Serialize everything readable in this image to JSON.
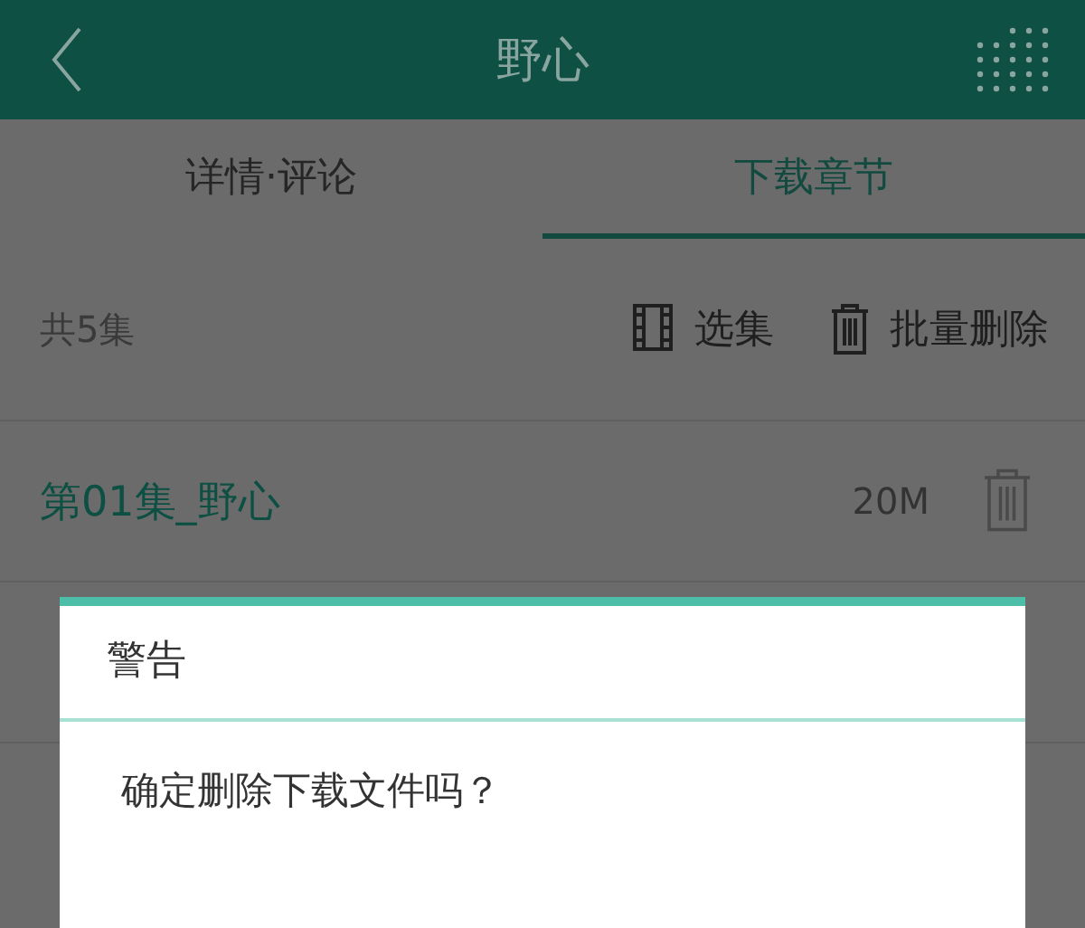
{
  "header": {
    "title": "野心"
  },
  "tabs": [
    {
      "label": "详情·评论",
      "selected": false
    },
    {
      "label": "下载章节",
      "selected": true
    }
  ],
  "toolbar": {
    "count": "共5集",
    "actions": [
      {
        "kind": "select",
        "label": "选集"
      },
      {
        "kind": "delete",
        "label": "批量删除"
      }
    ]
  },
  "episodes": [
    {
      "title": "第01集_野心",
      "size": "20M",
      "selected": true
    }
  ],
  "dialog": {
    "title": "警告",
    "message": "确定删除下载文件吗？"
  }
}
